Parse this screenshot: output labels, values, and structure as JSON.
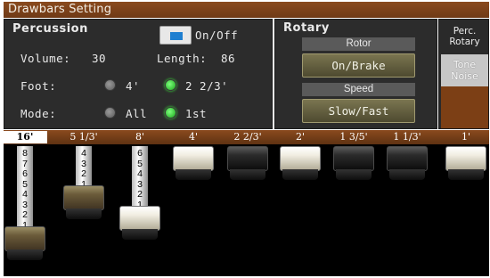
{
  "window": {
    "title": "Drawbars Setting"
  },
  "percussion": {
    "title": "Percussion",
    "onoff_label": "On/Off",
    "onoff_checked": true,
    "volume_label": "Volume:",
    "volume_value": "30",
    "length_label": "Length:",
    "length_value": "86",
    "foot_label": "Foot:",
    "foot_options": [
      "4'",
      "2 2/3'"
    ],
    "foot_selected": "2 2/3'",
    "mode_label": "Mode:",
    "mode_options": [
      "All",
      "1st"
    ],
    "mode_selected": "1st"
  },
  "rotary": {
    "title": "Rotary",
    "rotor_header": "Rotor",
    "rotor_button": "On/Brake",
    "speed_header": "Speed",
    "speed_button": "Slow/Fast"
  },
  "perc_rotary": {
    "title_line1": "Perc.",
    "title_line2": "Rotary",
    "button_line1": "Tone",
    "button_line2": "Noise"
  },
  "drawbars": [
    {
      "footage": "16'",
      "selected": true,
      "color": "brown",
      "level": 8,
      "numbers": [
        "8",
        "7",
        "6",
        "5",
        "4",
        "3",
        "2",
        "1"
      ]
    },
    {
      "footage": "5 1/3'",
      "selected": false,
      "color": "brown",
      "level": 4,
      "numbers": [
        "4",
        "3",
        "2",
        "1"
      ]
    },
    {
      "footage": "8'",
      "selected": false,
      "color": "white",
      "level": 6,
      "numbers": [
        "6",
        "5",
        "4",
        "3",
        "2",
        "1"
      ]
    },
    {
      "footage": "4'",
      "selected": false,
      "color": "white",
      "level": 0,
      "numbers": []
    },
    {
      "footage": "2 2/3'",
      "selected": false,
      "color": "black",
      "level": 0,
      "numbers": []
    },
    {
      "footage": "2'",
      "selected": false,
      "color": "white",
      "level": 0,
      "numbers": []
    },
    {
      "footage": "1 3/5'",
      "selected": false,
      "color": "black",
      "level": 0,
      "numbers": []
    },
    {
      "footage": "1 1/3'",
      "selected": false,
      "color": "black",
      "level": 0,
      "numbers": []
    },
    {
      "footage": "1'",
      "selected": false,
      "color": "white",
      "level": 0,
      "numbers": []
    }
  ],
  "colors": {
    "title_bar": "#7a4219",
    "panel_bg": "#2c2c2c",
    "radio_on": "#2fd32f",
    "checkbox_fill": "#1f7fd0",
    "rotary_button": "#6a6545"
  }
}
